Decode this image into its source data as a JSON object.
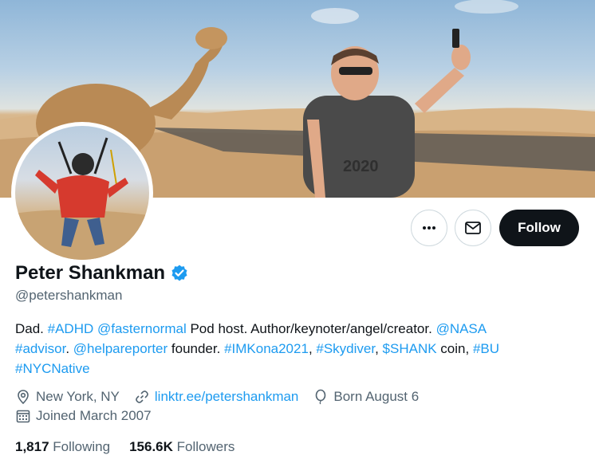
{
  "profile": {
    "name": "Peter Shankman",
    "handle": "@petershankman",
    "follow_label": "Follow"
  },
  "bio": {
    "parts": [
      {
        "text": "Dad. ",
        "link": false
      },
      {
        "text": "#ADHD",
        "link": true
      },
      {
        "text": " ",
        "link": false
      },
      {
        "text": "@fasternormal",
        "link": true
      },
      {
        "text": " Pod host. Author/keynoter/angel/creator. ",
        "link": false
      },
      {
        "text": "@NASA",
        "link": true
      },
      {
        "text": "#advisor",
        "link": true
      },
      {
        "text": ". ",
        "link": false
      },
      {
        "text": "@helpareporter",
        "link": true
      },
      {
        "text": " founder. ",
        "link": false
      },
      {
        "text": "#IMKona2021",
        "link": true
      },
      {
        "text": ", ",
        "link": false
      },
      {
        "text": "#Skydiver",
        "link": true
      },
      {
        "text": ", ",
        "link": false
      },
      {
        "text": "$SHANK",
        "link": true
      },
      {
        "text": " coin, ",
        "link": false
      },
      {
        "text": "#BU",
        "link": true
      },
      {
        "text": "#NYCNative",
        "link": true
      }
    ]
  },
  "meta": {
    "location": "New York, NY",
    "url": "linktr.ee/petershankman",
    "birthday": "Born August 6",
    "joined": "Joined March 2007"
  },
  "stats": {
    "following_count": "1,817",
    "following_label": "Following",
    "followers_count": "156.6K",
    "followers_label": "Followers"
  },
  "colors": {
    "accent": "#1d9bf0",
    "text": "#0f1419",
    "muted": "#536471",
    "follow_bg": "#0f1419"
  },
  "icons": {
    "more": "more-horizontal-icon",
    "mail": "mail-icon",
    "verified": "verified-badge-icon",
    "location": "location-pin-icon",
    "link": "link-icon",
    "birthday": "balloon-icon",
    "calendar": "calendar-icon"
  }
}
